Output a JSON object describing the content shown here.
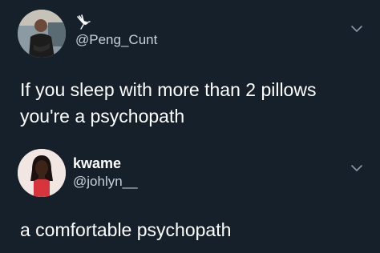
{
  "tweets": [
    {
      "handle": "@Peng_Cunt",
      "text_line1": "If you sleep with more than 2 pillows",
      "text_line2": "you're a psychopath"
    },
    {
      "display_name": "kwame",
      "handle": "@johlyn__",
      "text": "a comfortable psychopath"
    }
  ],
  "colors": {
    "background": "#15202b",
    "text_primary": "#ffffff",
    "text_secondary": "#c9d1d9",
    "chevron": "#8899a6"
  },
  "icons": {
    "tweet1_badge": "dove-icon",
    "menu": "chevron-down-icon"
  }
}
